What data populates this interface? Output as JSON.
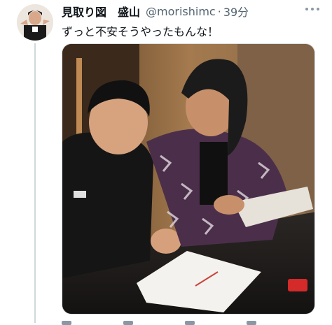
{
  "tweet": {
    "display_name": "見取り図　盛山",
    "handle": "@morishimc",
    "separator": "·",
    "time": "39分",
    "text": "ずっと不安そうやったもんな！",
    "more_icon": "more-horizontal-icon",
    "photo_icon": "attached-photo"
  },
  "colors": {
    "name": "#0f1419",
    "secondary": "#536471",
    "thread_line": "#cfd9de"
  }
}
